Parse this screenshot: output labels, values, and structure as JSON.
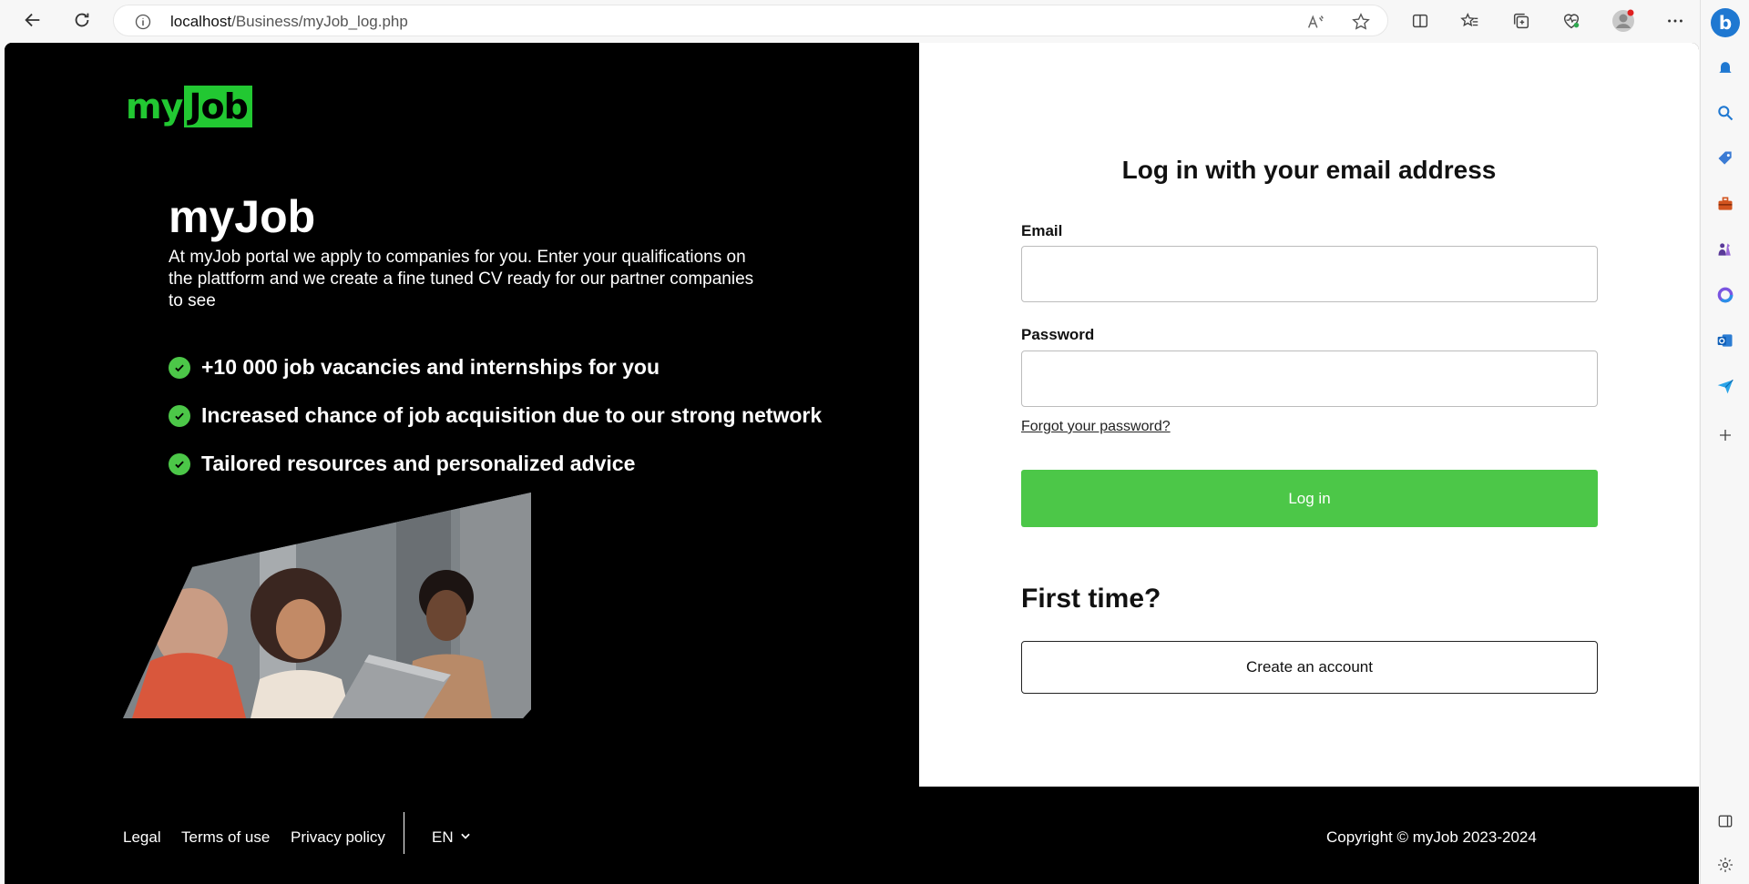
{
  "browser": {
    "url_host": "localhost",
    "url_path": "/Business/myJob_log.php"
  },
  "brand": {
    "logo_my": "my",
    "logo_job": "Job",
    "title": "myJob",
    "description": "At myJob portal we apply to companies for you. Enter your qualifications on the plattform and we create a fine tuned CV ready for our partner companies to see",
    "features": [
      "+10 000 job vacancies and internships for you",
      "Increased chance of job acquisition due to our strong network",
      "Tailored resources and personalized advice"
    ]
  },
  "login": {
    "title": "Log in with your email address",
    "email_label": "Email",
    "email_value": "",
    "password_label": "Password",
    "password_value": "",
    "forgot_label": "Forgot your password?",
    "login_button": "Log in"
  },
  "signup": {
    "heading": "First time?",
    "create_button": "Create an account"
  },
  "footer": {
    "links": [
      "Legal",
      "Terms of use",
      "Privacy policy"
    ],
    "language": "EN",
    "copyright": "Copyright © myJob 2023-2024"
  },
  "colors": {
    "accent": "#4cc748",
    "logo_green": "#22c832",
    "background_dark": "#000000"
  }
}
